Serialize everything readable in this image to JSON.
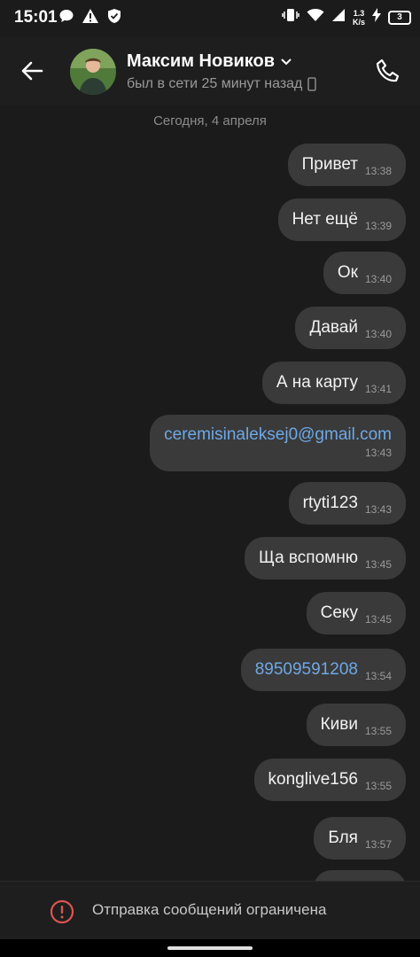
{
  "status_bar": {
    "time": "15:01",
    "net_speed_value": "1.3",
    "net_speed_unit": "K/s",
    "battery": "3",
    "left_icons": [
      "chat-bubble-icon",
      "warning-icon",
      "shield-icon"
    ],
    "right_icons": [
      "vibrate-icon",
      "wifi-icon",
      "signal-icon",
      "charging-icon",
      "battery-icon"
    ]
  },
  "header": {
    "name": "Максим Новиков",
    "status": "был в сети 25 минут назад"
  },
  "chat": {
    "date": "Сегодня, 4 апреля",
    "messages": [
      {
        "text": "Привет",
        "time": "13:38"
      },
      {
        "text": "Нет ещё",
        "time": "13:39"
      },
      {
        "text": "Ок",
        "time": "13:40"
      },
      {
        "text": "Давай",
        "time": "13:40"
      },
      {
        "text": "А на карту",
        "time": "13:41"
      },
      {
        "text": "ceremisinaleksej0@gmail.com",
        "time": "13:43",
        "link": true
      },
      {
        "text": "rtyti123",
        "time": "13:43"
      },
      {
        "text": "Ща вспомню",
        "time": "13:45"
      },
      {
        "text": "Секу",
        "time": "13:45"
      },
      {
        "text": "89509591208",
        "time": "13:54",
        "link": true
      },
      {
        "text": "Киви",
        "time": "13:55"
      },
      {
        "text": "konglive156",
        "time": "13:55"
      },
      {
        "text": "Бля",
        "time": "13:57"
      }
    ]
  },
  "footer": {
    "restricted_text": "Отправка сообщений ограничена"
  },
  "colors": {
    "background": "#1b1b1b",
    "bubble": "#3a3a3a",
    "link": "#6ea8e6",
    "warning": "#e0534f"
  }
}
